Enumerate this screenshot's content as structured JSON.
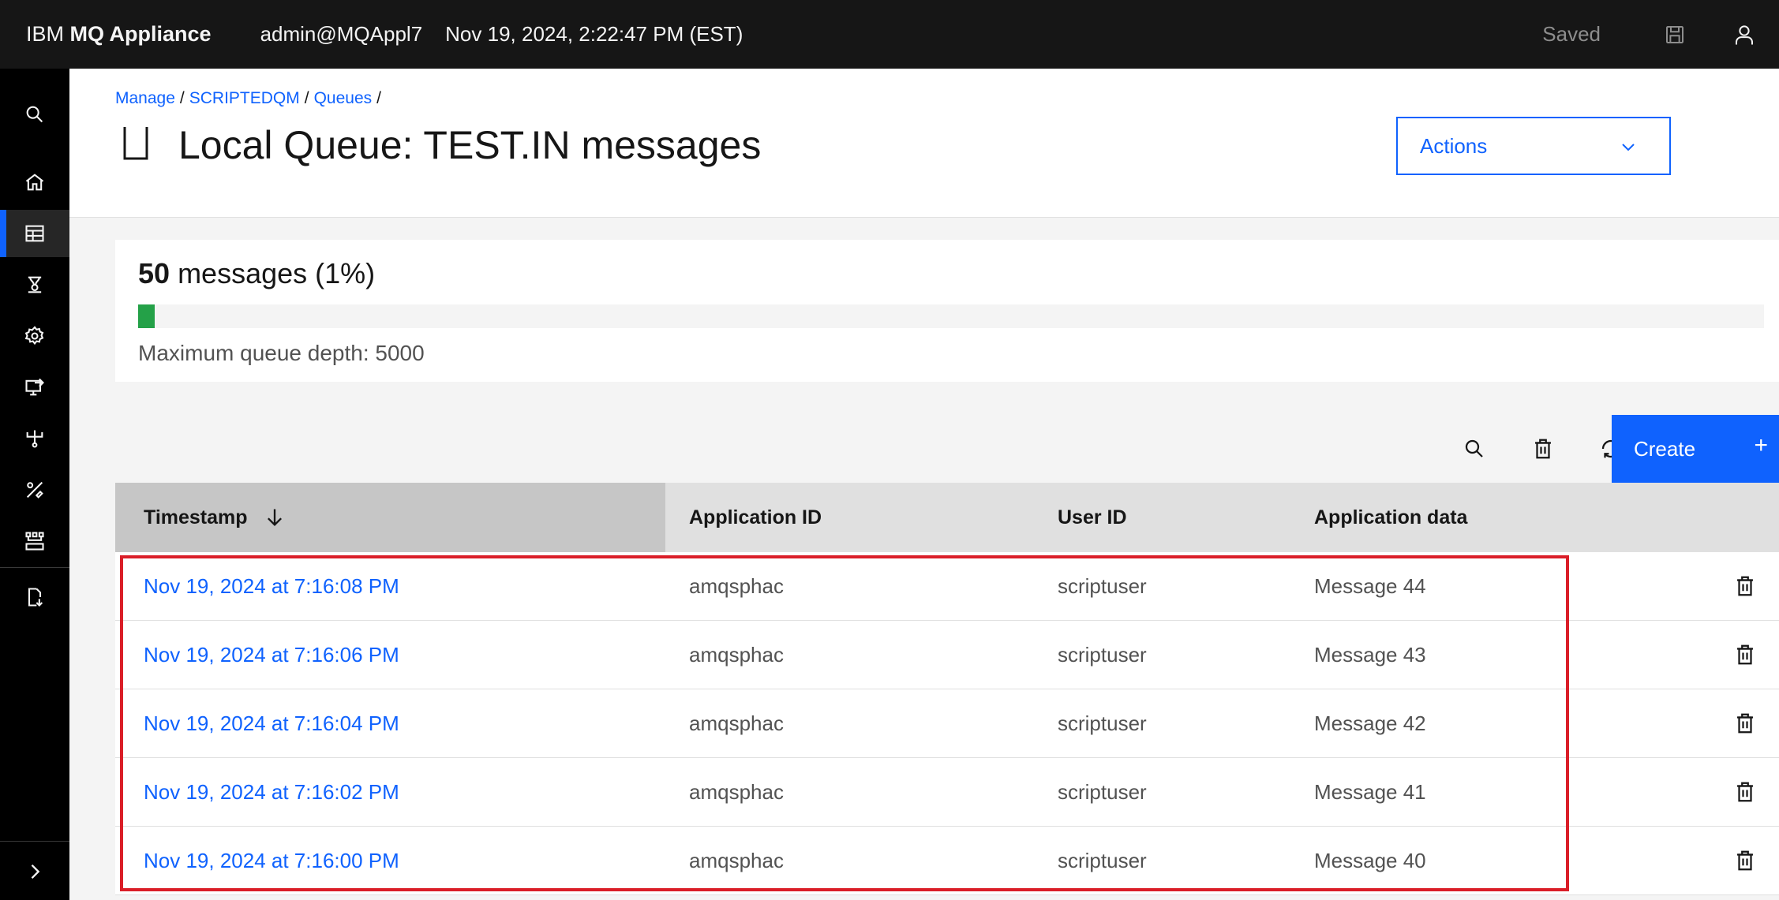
{
  "header": {
    "brand_prefix": "IBM",
    "brand_name": "MQ Appliance",
    "user": "admin@MQAppl7",
    "datetime": "Nov 19, 2024, 2:22:47 PM (EST)",
    "saved_label": "Saved",
    "icons": [
      "save-icon",
      "user-icon"
    ]
  },
  "sidenav": {
    "items": [
      "search-icon",
      "home-icon",
      "table-icon",
      "monitor-icon",
      "gear-icon",
      "deploy-icon",
      "network-icon",
      "tools-icon",
      "connection-icon",
      "export-icon"
    ],
    "expand_icon": "chevron-right-icon",
    "active_index": 2
  },
  "breadcrumb": {
    "items": [
      "Manage",
      "SCRIPTEDQM",
      "Queues"
    ],
    "separator": "/"
  },
  "page": {
    "title": "Local Queue: TEST.IN messages",
    "actions_label": "Actions"
  },
  "depth": {
    "count": "50",
    "label": "messages (1%)",
    "fill_percent": 1,
    "fill_color": "#24a148",
    "max_label": "Maximum queue depth: 5000"
  },
  "toolbar": {
    "icons": [
      "search-icon",
      "trash-icon",
      "refresh-icon"
    ],
    "create_label": "Create",
    "create_icon": "+"
  },
  "table": {
    "columns": [
      "Timestamp",
      "Application ID",
      "User ID",
      "Application data"
    ],
    "sort_column": "Timestamp",
    "sort_direction": "descending",
    "rows": [
      {
        "timestamp": "Nov 19, 2024 at 7:16:08 PM",
        "app_id": "amqsphac",
        "user_id": "scriptuser",
        "data": "Message 44"
      },
      {
        "timestamp": "Nov 19, 2024 at 7:16:06 PM",
        "app_id": "amqsphac",
        "user_id": "scriptuser",
        "data": "Message 43"
      },
      {
        "timestamp": "Nov 19, 2024 at 7:16:04 PM",
        "app_id": "amqsphac",
        "user_id": "scriptuser",
        "data": "Message 42"
      },
      {
        "timestamp": "Nov 19, 2024 at 7:16:02 PM",
        "app_id": "amqsphac",
        "user_id": "scriptuser",
        "data": "Message 41"
      },
      {
        "timestamp": "Nov 19, 2024 at 7:16:00 PM",
        "app_id": "amqsphac",
        "user_id": "scriptuser",
        "data": "Message 40"
      }
    ]
  },
  "colors": {
    "accent": "#0f62fe",
    "highlight": "#da1e28",
    "header_bg": "#161616"
  }
}
